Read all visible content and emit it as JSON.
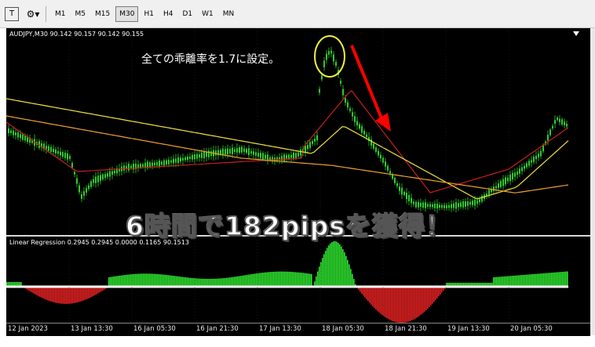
{
  "toolbar": {
    "template_icon": "T",
    "tools_icon": "⚙▾",
    "timeframes": [
      "M1",
      "M5",
      "M15",
      "M30",
      "H1",
      "H4",
      "D1",
      "W1",
      "MN"
    ],
    "active_timeframe": "M30"
  },
  "chart": {
    "symbol_info": "AUDJPY,M30  90.142 90.157 90.142 90.155",
    "annotation": "全ての乖離率を1.7に設定。",
    "banner": "6時間で182pipsを獲得！"
  },
  "indicator": {
    "label": "Linear Regression  0.2945 0.2945 0.0000 0.1165 90.1513"
  },
  "time_axis": {
    "labels": [
      "12 Jan 2023",
      "13 Jan 13:30",
      "16 Jan 05:30",
      "16 Jan 21:30",
      "17 Jan 13:30",
      "18 Jan 05:30",
      "18 Jan 21:30",
      "19 Jan 13:30",
      "20 Jan 05:30"
    ]
  },
  "colors": {
    "background": "#000000",
    "candle_up": "#2ecc2e",
    "ma_red": "#c81e1e",
    "ma_yellow": "#f0e040",
    "ma_orange": "#f0a030",
    "hist_pos": "#2ee62e",
    "hist_neg": "#e62222",
    "arrow": "#ff0000",
    "circle": "#f0f040"
  }
}
